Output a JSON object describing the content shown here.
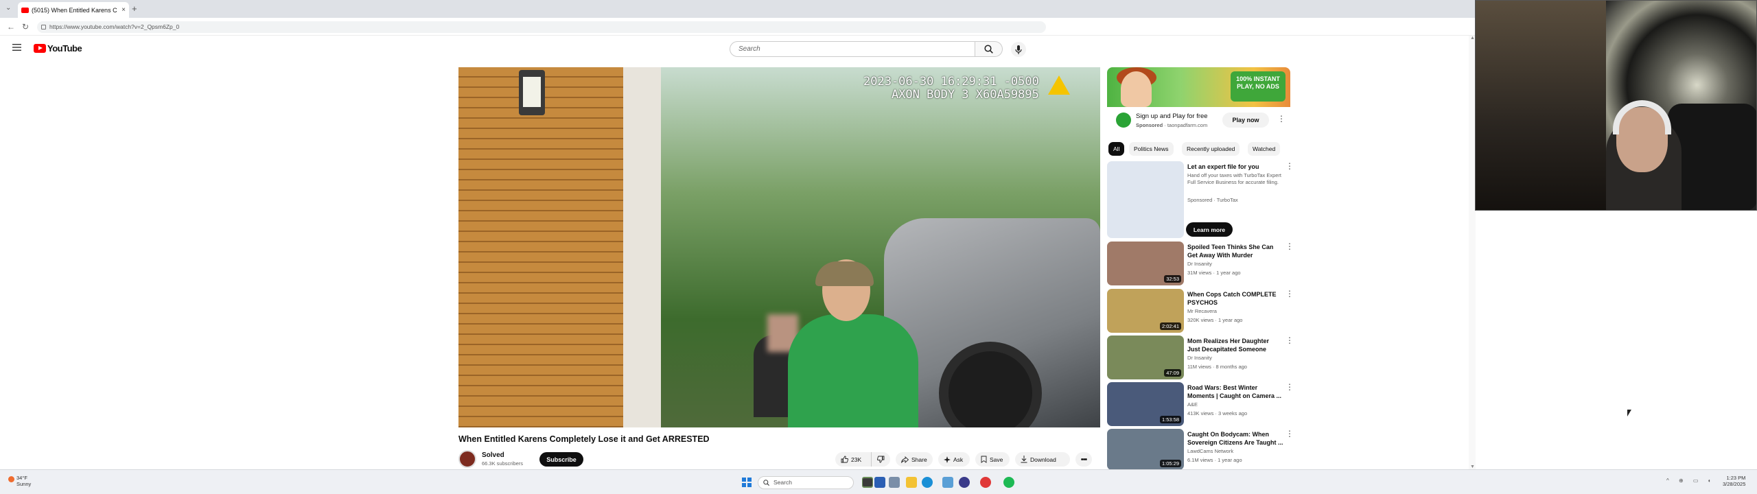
{
  "browser": {
    "tab_title": "(5015) When Entitled Karens C",
    "tab_close": "×",
    "new_tab": "+",
    "url": "https://www.youtube.com/watch?v=2_Qpsm6Zp_0"
  },
  "header": {
    "logo_text": "YouTube",
    "search_placeholder": "Search"
  },
  "video": {
    "stamp_line1": "2023-06-30 16:29:31 -0500",
    "stamp_line2": "AXON BODY 3 X60A59895",
    "title": "When Entitled Karens Completely Lose it and Get ARRESTED",
    "channel": "Solved",
    "subscribers": "66.3K subscribers",
    "subscribe_label": "Subscribe",
    "actions": {
      "likes": "23K",
      "share": "Share",
      "ask": "Ask",
      "save": "Save",
      "download": "Download"
    }
  },
  "sidebar": {
    "ad": {
      "badge_text": "100% INSTANT PLAY, NO ADS",
      "title": "Sign up and Play for free",
      "sponsor_label": "Sponsored",
      "sponsor_domain": "taonpadfarm.com",
      "cta": "Play now"
    },
    "chips": [
      "All",
      "Politics News",
      "Recently uploaded",
      "Watched"
    ],
    "items": [
      {
        "title": "Let an expert file for you",
        "channel": "Hand off your taxes with TurboTax Expert Full Service Business for accurate filing.",
        "meta": "Sponsored · TurboTax",
        "duration": "",
        "cta": "Learn more",
        "thumb_color": "#dfe6f0"
      },
      {
        "title": "Spoiled Teen Thinks She Can Get Away With Murder",
        "channel": "Dr Insanity",
        "meta": "31M views · 1 year ago",
        "duration": "32:53",
        "thumb_color": "#a07a68"
      },
      {
        "title": "When Cops Catch COMPLETE PSYCHOS",
        "channel": "Mr Recavera",
        "meta": "320K views · 1 year ago",
        "duration": "2:02:41",
        "thumb_color": "#c0a25a"
      },
      {
        "title": "Mom Realizes Her Daughter Just Decapitated Someone",
        "channel": "Dr Insanity",
        "meta": "11M views · 8 months ago",
        "duration": "47:09",
        "thumb_color": "#7a8a5a"
      },
      {
        "title": "Road Wars: Best Winter Moments | Caught on Camera ...",
        "channel": "A&E",
        "meta": "413K views · 3 weeks ago",
        "duration": "1:53:58",
        "thumb_color": "#4a5a7a"
      },
      {
        "title": "Caught On Bodycam: When Sovereign Citizens Are Taught ...",
        "channel": "LawdCams Network",
        "meta": "6.1M views · 1 year ago",
        "duration": "1:05:29",
        "thumb_color": "#6a7a8a"
      }
    ]
  },
  "taskbar": {
    "weather_temp": "34°F",
    "weather_desc": "Sunny",
    "search_placeholder": "Search",
    "time": "1:23 PM",
    "date": "3/28/2025"
  }
}
